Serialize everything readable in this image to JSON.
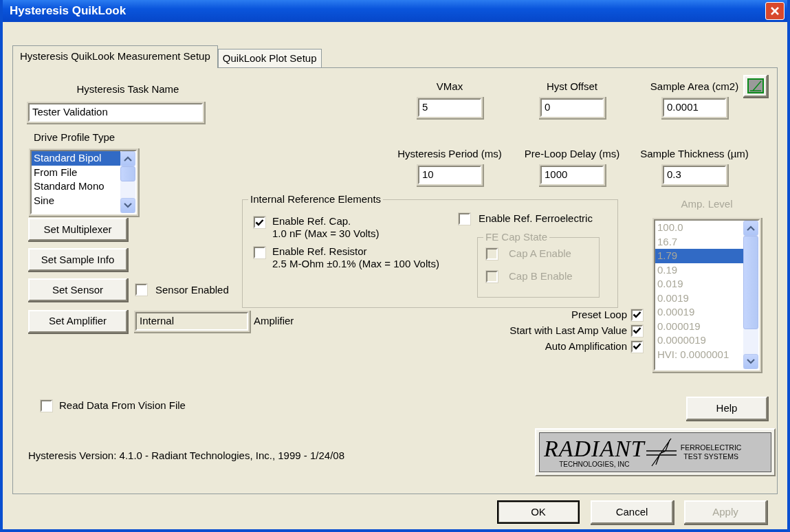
{
  "window": {
    "title": "Hysteresis QuikLook"
  },
  "tabs": [
    {
      "label": "Hysteresis QuikLook Measurement Setup",
      "selected": true
    },
    {
      "label": "QuikLook Plot Setup",
      "selected": false
    }
  ],
  "task_name": {
    "label": "Hysteresis Task Name",
    "value": "Tester Validation"
  },
  "drive_profile": {
    "label": "Drive Profile Type",
    "items": [
      {
        "label": "Standard Bipol",
        "selected": true
      },
      {
        "label": "From File",
        "selected": false
      },
      {
        "label": "Standard Mono",
        "selected": false
      },
      {
        "label": "Sine",
        "selected": false
      }
    ]
  },
  "fields": [
    {
      "label": "VMax",
      "value": "5"
    },
    {
      "label": "Hyst Offset",
      "value": "0"
    },
    {
      "label": "Sample Area (cm2)",
      "value": "0.0001"
    },
    {
      "label": "Hysteresis Period (ms)",
      "value": "10"
    },
    {
      "label": "Pre-Loop Delay (ms)",
      "value": "1000"
    },
    {
      "label": "Sample Thickness (µm)",
      "value": "0.3"
    }
  ],
  "side_buttons": [
    "Set Multiplexer",
    "Set Sample Info",
    "Set Sensor",
    "Set Amplifier"
  ],
  "sensor_enabled": {
    "label": "Sensor Enabled",
    "checked": false
  },
  "amplifier": {
    "value": "Internal",
    "label": "Amplifier"
  },
  "reference_group": {
    "title": "Internal Reference Elements",
    "items": [
      {
        "label": "Enable Ref. Cap.",
        "detail": "1.0 nF (Max = 30 Volts)",
        "checked": true
      },
      {
        "label": "Enable Ref. Resistor",
        "detail": "2.5 M-Ohm ±0.1% (Max = 100 Volts)",
        "checked": false
      }
    ],
    "ferroelectric": {
      "label": "Enable Ref. Ferroelectric",
      "checked": false
    },
    "fe_cap_state": {
      "title": "FE Cap State",
      "disabled": true,
      "items": [
        {
          "label": "Cap A Enable",
          "checked": false
        },
        {
          "label": "Cap B Enable",
          "checked": false
        }
      ]
    }
  },
  "loop_options": [
    {
      "label": "Preset Loop",
      "checked": true
    },
    {
      "label": "Start with Last Amp Value",
      "checked": true
    },
    {
      "label": "Auto Amplification",
      "checked": true
    }
  ],
  "amp_level": {
    "label": "Amp. Level",
    "disabled": true,
    "items": [
      {
        "label": "100.0",
        "selected": false
      },
      {
        "label": "16.7",
        "selected": false
      },
      {
        "label": "1.79",
        "selected": true
      },
      {
        "label": "0.19",
        "selected": false
      },
      {
        "label": "0.019",
        "selected": false
      },
      {
        "label": "0.0019",
        "selected": false
      },
      {
        "label": "0.00019",
        "selected": false
      },
      {
        "label": "0.000019",
        "selected": false
      },
      {
        "label": "0.0000019",
        "selected": false
      },
      {
        "label": "HVI: 0.0000001",
        "selected": false
      }
    ]
  },
  "read_vision": {
    "label": "Read Data From Vision File",
    "checked": false
  },
  "help_button": "Help",
  "version": "Hysteresis Version: 4.1.0 - Radiant Technologies, Inc., 1999 - 1/24/08",
  "logo": {
    "name": "RADIANT",
    "subtitle": "TECHNOLOGIES, INC",
    "line_1": "FERROELECTRIC",
    "line_2": "TEST SYSTEMS"
  },
  "dialog_buttons": [
    {
      "label": "OK",
      "default": true,
      "disabled": false
    },
    {
      "label": "Cancel",
      "default": false,
      "disabled": false
    },
    {
      "label": "Apply",
      "default": false,
      "disabled": true
    }
  ]
}
